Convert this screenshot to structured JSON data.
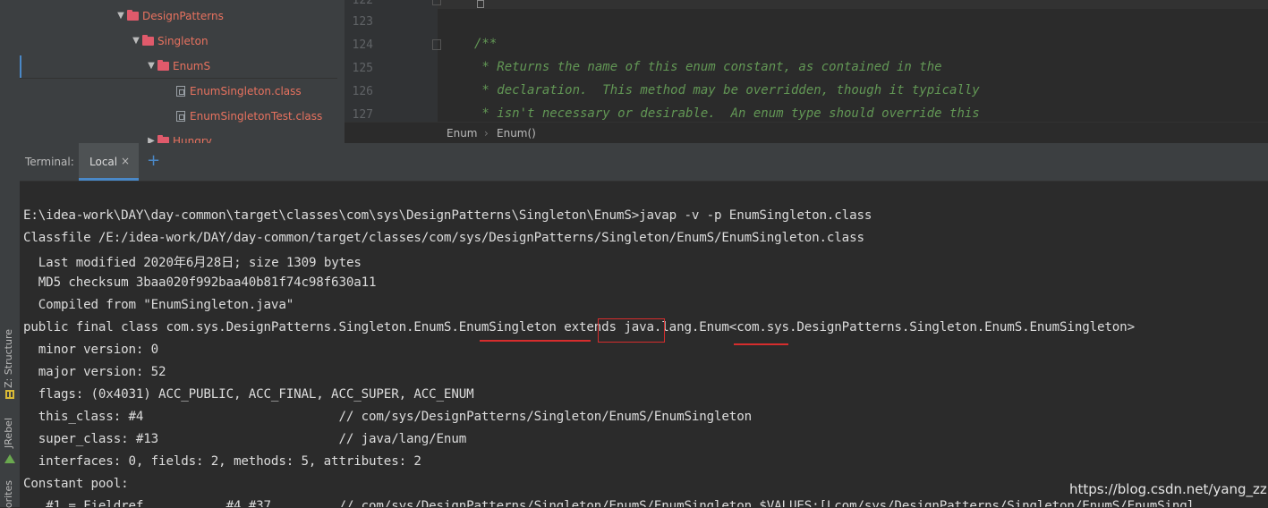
{
  "sidebar_tools": {
    "structure_label": "Z: Structure",
    "jrebel_label": "JRebel",
    "favorites_label": "orites"
  },
  "project_tree": {
    "items": [
      {
        "label": "DesignPatterns",
        "kind": "folder"
      },
      {
        "label": "Singleton",
        "kind": "folder"
      },
      {
        "label": "EnumS",
        "kind": "folder"
      },
      {
        "label": "EnumSingleton.class",
        "kind": "file"
      },
      {
        "label": "EnumSingletonTest.class",
        "kind": "file"
      },
      {
        "label": "Hungry",
        "kind": "folder"
      }
    ]
  },
  "editor": {
    "lines": [
      {
        "no": "122",
        "text": ""
      },
      {
        "no": "123",
        "text": ""
      },
      {
        "no": "124",
        "text": "/**"
      },
      {
        "no": "125",
        "text": " * Returns the name of this enum constant, as contained in the"
      },
      {
        "no": "126",
        "text": " * declaration.  This method may be overridden, though it typically"
      },
      {
        "no": "127",
        "text": " * isn't necessary or desirable.  An enum type should override this"
      }
    ]
  },
  "breadcrumb": {
    "first": "Enum",
    "separator": "›",
    "second": "Enum()"
  },
  "terminal": {
    "label": "Terminal:",
    "tab_label": "Local",
    "tab_close": "×",
    "add_tab": "+",
    "lines": [
      "E:\\idea-work\\DAY\\day-common\\target\\classes\\com\\sys\\DesignPatterns\\Singleton\\EnumS>javap -v -p EnumSingleton.class",
      "Classfile /E:/idea-work/DAY/day-common/target/classes/com/sys/DesignPatterns/Singleton/EnumS/EnumSingleton.class",
      "  Last modified 2020年6月28日; size 1309 bytes",
      "  MD5 checksum 3baa020f992baa40b81f74c98f630a11",
      "  Compiled from \"EnumSingleton.java\"",
      "public final class com.sys.DesignPatterns.Singleton.EnumS.EnumSingleton extends java.lang.Enum<com.sys.DesignPatterns.Singleton.EnumS.EnumSingleton>",
      "  minor version: 0",
      "  major version: 52",
      "  flags: (0x4031) ACC_PUBLIC, ACC_FINAL, ACC_SUPER, ACC_ENUM",
      "  this_class: #4                          // com/sys/DesignPatterns/Singleton/EnumS/EnumSingleton",
      "  super_class: #13                        // java/lang/Enum",
      "  interfaces: 0, fields: 2, methods: 5, attributes: 2",
      "Constant pool:",
      "   #1 = Fieldref           #4.#37         // com/sys/DesignPatterns/Singleton/EnumS/EnumSingleton.$VALUES:[Lcom/sys/DesignPatterns/Singleton/EnumS/EnumSingl"
    ]
  },
  "watermark": "https://blog.csdn.net/yang_zzu",
  "colors": {
    "highlight": "#d62d2d",
    "accent": "#4a88c7",
    "folder": "#e05a6b",
    "comment": "#629755"
  }
}
